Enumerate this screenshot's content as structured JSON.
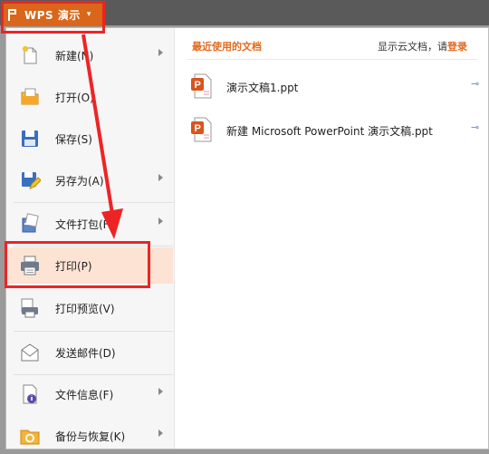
{
  "app": {
    "button_label": "WPS 演示",
    "caret": "▾"
  },
  "menu": {
    "items": [
      {
        "label": "新建(N)",
        "icon": "new-document-icon",
        "submenu": true
      },
      {
        "label": "打开(O)",
        "icon": "open-folder-icon",
        "submenu": false
      },
      {
        "label": "保存(S)",
        "icon": "save-icon",
        "submenu": false
      },
      {
        "label": "另存为(A)",
        "icon": "save-as-icon",
        "submenu": true
      },
      {
        "label": "文件打包(F)",
        "icon": "package-icon",
        "submenu": true
      },
      {
        "label": "打印(P)",
        "icon": "print-icon",
        "submenu": false,
        "highlighted": true
      },
      {
        "label": "打印预览(V)",
        "icon": "print-preview-icon",
        "submenu": false
      },
      {
        "label": "发送邮件(D)",
        "icon": "mail-icon",
        "submenu": false
      },
      {
        "label": "文件信息(F)",
        "icon": "file-info-icon",
        "submenu": true
      },
      {
        "label": "备份与恢复(K)",
        "icon": "backup-restore-icon",
        "submenu": true
      }
    ]
  },
  "recent": {
    "header": "最近使用的文档",
    "cloud_hint": "显示云文档，请",
    "login": "登录",
    "files": [
      {
        "name": "演示文稿1.ppt",
        "icon": "ppt-file-icon"
      },
      {
        "name": "新建 Microsoft PowerPoint 演示文稿.ppt",
        "icon": "ppt-file-icon"
      }
    ]
  },
  "colors": {
    "accent": "#d9661b",
    "highlight": "#fde3d4",
    "annotation": "#ee2424"
  }
}
